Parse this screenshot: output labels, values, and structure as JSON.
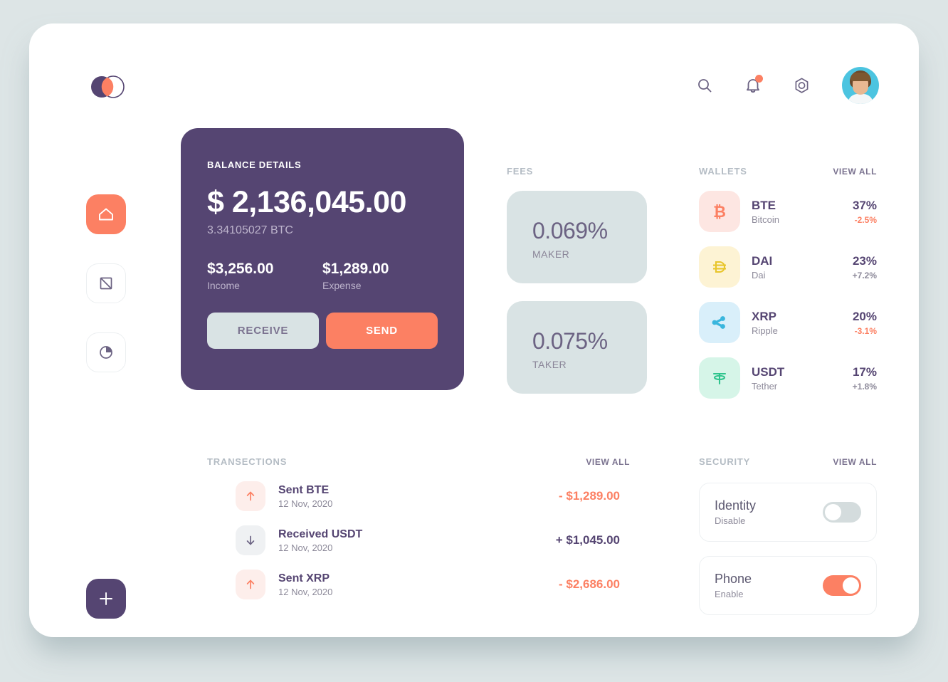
{
  "header": {
    "logo_name": "venn-logo",
    "icons": [
      {
        "name": "search-icon",
        "label": "Search"
      },
      {
        "name": "notification-bell-icon",
        "label": "Notifications"
      },
      {
        "name": "settings-gear-icon",
        "label": "Settings"
      }
    ],
    "avatar_label": "User profile"
  },
  "sidebar": {
    "items": [
      {
        "name": "sidebar-item-home",
        "icon": "home-icon",
        "active": true
      },
      {
        "name": "sidebar-item-cards",
        "icon": "card-slash-icon",
        "active": false
      },
      {
        "name": "sidebar-item-analytics",
        "icon": "pie-chart-icon",
        "active": false
      }
    ],
    "add_label": "+"
  },
  "balance": {
    "label": "BALANCE DETAILS",
    "amount": "$ 2,136,045.00",
    "btc": "3.34105027 BTC",
    "income_value": "$3,256.00",
    "income_label": "Income",
    "expense_value": "$1,289.00",
    "expense_label": "Expense",
    "receive_label": "RECEIVE",
    "send_label": "SEND"
  },
  "fees": {
    "label": "FEES",
    "cards": [
      {
        "value": "0.069%",
        "name": "MAKER"
      },
      {
        "value": "0.075%",
        "name": "TAKER"
      }
    ]
  },
  "wallets": {
    "label": "WALLETS",
    "view_all": "VIEW ALL",
    "items": [
      {
        "symbol": "BTE",
        "name": "Bitcoin",
        "share": "37%",
        "change": "-2.5%",
        "positive": false,
        "icon": "bitcoin-icon",
        "tile_bg": "#fde6e2",
        "glyph_color": "#fc8063"
      },
      {
        "symbol": "DAI",
        "name": "Dai",
        "share": "23%",
        "change": "+7.2%",
        "positive": true,
        "icon": "dai-icon",
        "tile_bg": "#fdf3d4",
        "glyph_color": "#e8c52b"
      },
      {
        "symbol": "XRP",
        "name": "Ripple",
        "share": "20%",
        "change": "-3.1%",
        "positive": false,
        "icon": "ripple-icon",
        "tile_bg": "#d9effa",
        "glyph_color": "#3ab6dd"
      },
      {
        "symbol": "USDT",
        "name": "Tether",
        "share": "17%",
        "change": "+1.8%",
        "positive": true,
        "icon": "tether-icon",
        "tile_bg": "#d6f5e8",
        "glyph_color": "#2fc48d"
      }
    ]
  },
  "transactions": {
    "label": "TRANSECTIONS",
    "view_all": "VIEW ALL",
    "items": [
      {
        "title": "Sent BTE",
        "date": "12 Nov, 2020",
        "amount": "- $1,289.00",
        "direction": "sent",
        "icon": "arrow-up-icon"
      },
      {
        "title": "Received USDT",
        "date": "12 Nov, 2020",
        "amount": "+ $1,045.00",
        "direction": "received",
        "icon": "arrow-down-icon"
      },
      {
        "title": "Sent XRP",
        "date": "12 Nov, 2020",
        "amount": "- $2,686.00",
        "direction": "sent",
        "icon": "arrow-up-icon"
      }
    ]
  },
  "security": {
    "label": "SECURITY",
    "view_all": "VIEW ALL",
    "items": [
      {
        "title": "Identity",
        "state": "Disable",
        "enabled": false
      },
      {
        "title": "Phone",
        "state": "Enable",
        "enabled": true
      }
    ]
  },
  "colors": {
    "accent": "#fc8063",
    "purple": "#554572",
    "page_bg": "#dde5e6",
    "muted": "#8d8a9a",
    "fee_bg": "#d9e3e4"
  }
}
